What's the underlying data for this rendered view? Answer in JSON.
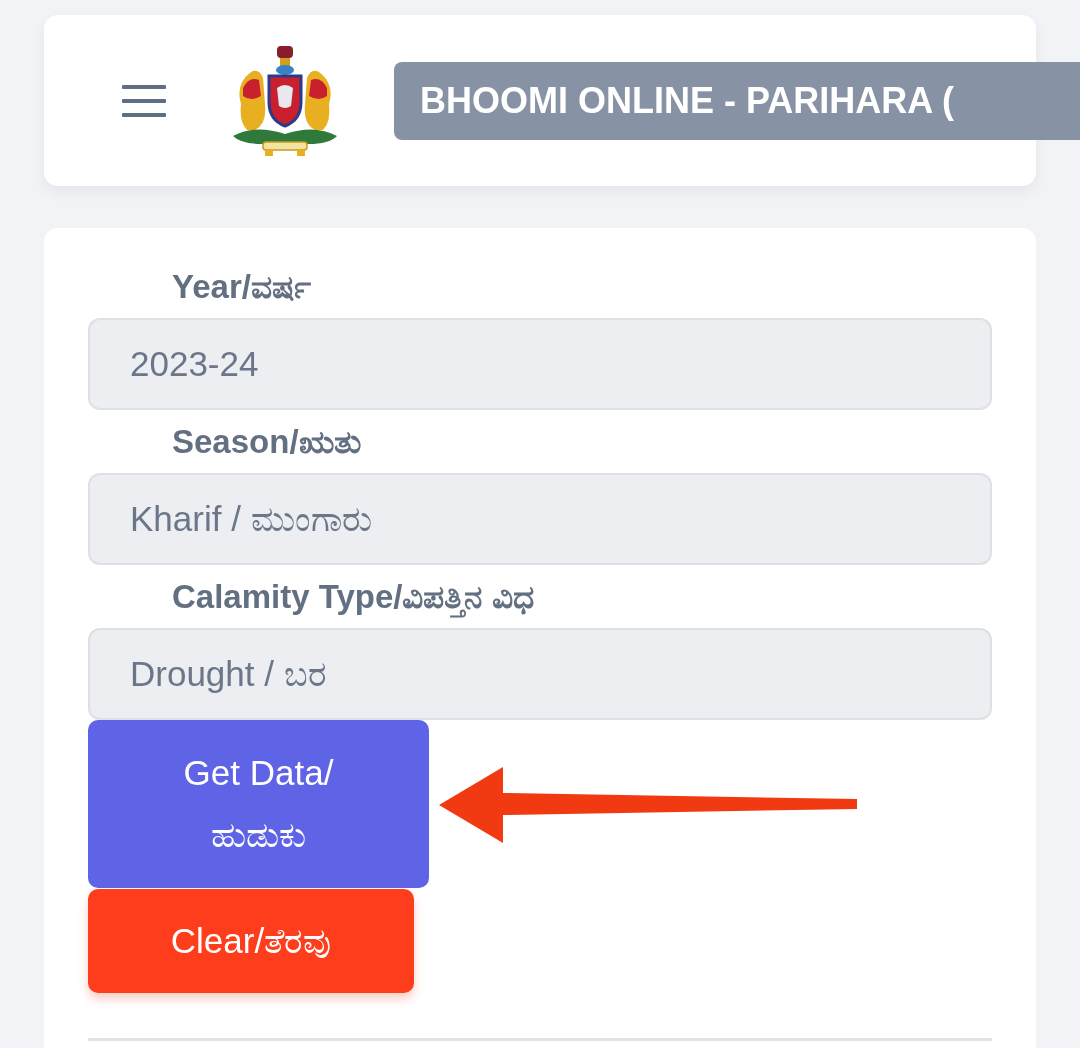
{
  "header": {
    "title": "BHOOMI ONLINE - PARIHARA ("
  },
  "form": {
    "fields": [
      {
        "label": "Year/ವರ್ಷ",
        "value": "2023-24"
      },
      {
        "label": "Season/ಋತು",
        "value": "Kharif / ಮುಂಗಾರು"
      },
      {
        "label": "Calamity Type/ವಿಪತ್ತಿನ ವಿಧ",
        "value": "Drought / ಬರ"
      }
    ],
    "buttons": [
      {
        "kind": "primary",
        "label": "Get Data/ ಹುಡುಕು"
      },
      {
        "kind": "danger",
        "label": "Clear/ತೆರವು"
      }
    ]
  }
}
